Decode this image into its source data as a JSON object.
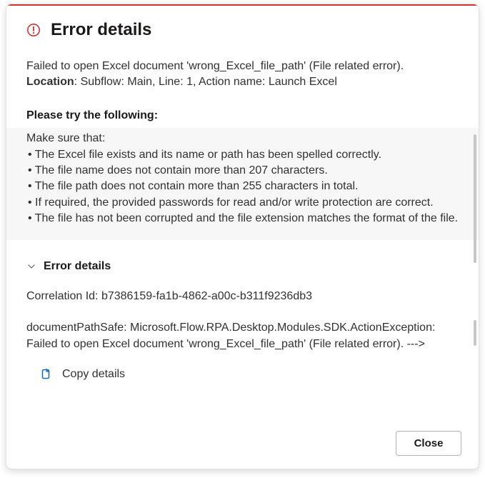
{
  "header": {
    "title": "Error details",
    "icon": "error-circle"
  },
  "description": {
    "message": "Failed to open Excel document 'wrong_Excel_file_path' (File related error).",
    "location_label": "Location",
    "location_value": ": Subflow: Main, Line: 1, Action name: Launch Excel"
  },
  "try_heading": "Please try the following:",
  "suggestion": {
    "intro": "Make sure that:",
    "items": [
      "• The Excel file exists and its name or path has been spelled correctly.",
      "• The file name does not contain more than 207 characters.",
      "• The file path does not contain more than 255 characters in total.",
      "• If required, the provided passwords for read and/or write protection are correct.",
      "• The file has not been corrupted and the file extension matches the format of the file."
    ]
  },
  "details_section": {
    "header_label": "Error details",
    "correlation_label": "Correlation Id: ",
    "correlation_value": "b7386159-fa1b-4862-a00c-b311f9236db3",
    "exception_text": "documentPathSafe: Microsoft.Flow.RPA.Desktop.Modules.SDK.ActionException: Failed to open Excel document 'wrong_Excel_file_path' (File related error). --->"
  },
  "copy_label": "Copy details",
  "close_label": "Close",
  "colors": {
    "accent_red": "#d13438",
    "link_blue": "#0f6cbd"
  }
}
